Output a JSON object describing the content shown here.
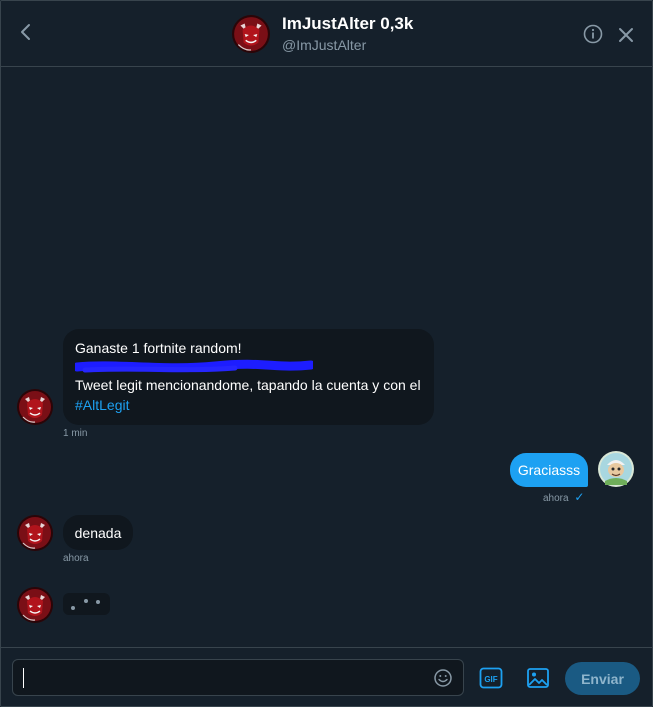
{
  "header": {
    "name": "ImJustAlter 0,3k",
    "handle": "@ImJustAlter",
    "icons": {
      "back": "chevron-left-icon",
      "info": "info-icon",
      "close": "close-icon"
    }
  },
  "messages": [
    {
      "from": "other",
      "lines": [
        "Ganaste 1 fortnite random!",
        "Tweet legit mencionandome, tapando la cuenta y con el"
      ],
      "hashtag": "#AltLegit",
      "time": "1 min",
      "redacted_line": true
    },
    {
      "from": "me",
      "text": "Graciasss",
      "time": "ahora",
      "read_receipt": "✓"
    },
    {
      "from": "other",
      "text": "denada",
      "time": "ahora"
    },
    {
      "from": "other",
      "typing": true
    }
  ],
  "composer": {
    "placeholder": "",
    "value": "",
    "send_label": "Enviar",
    "gif_label": "GIF",
    "icons": {
      "emoji": "emoji-icon",
      "gif": "gif-icon",
      "image": "image-icon"
    }
  },
  "colors": {
    "background": "#15202b",
    "bubble_in": "#10171e",
    "bubble_out": "#1da1f2",
    "accent": "#1da1f2",
    "muted": "#8899a6",
    "send_disabled": "#1a5a83"
  }
}
